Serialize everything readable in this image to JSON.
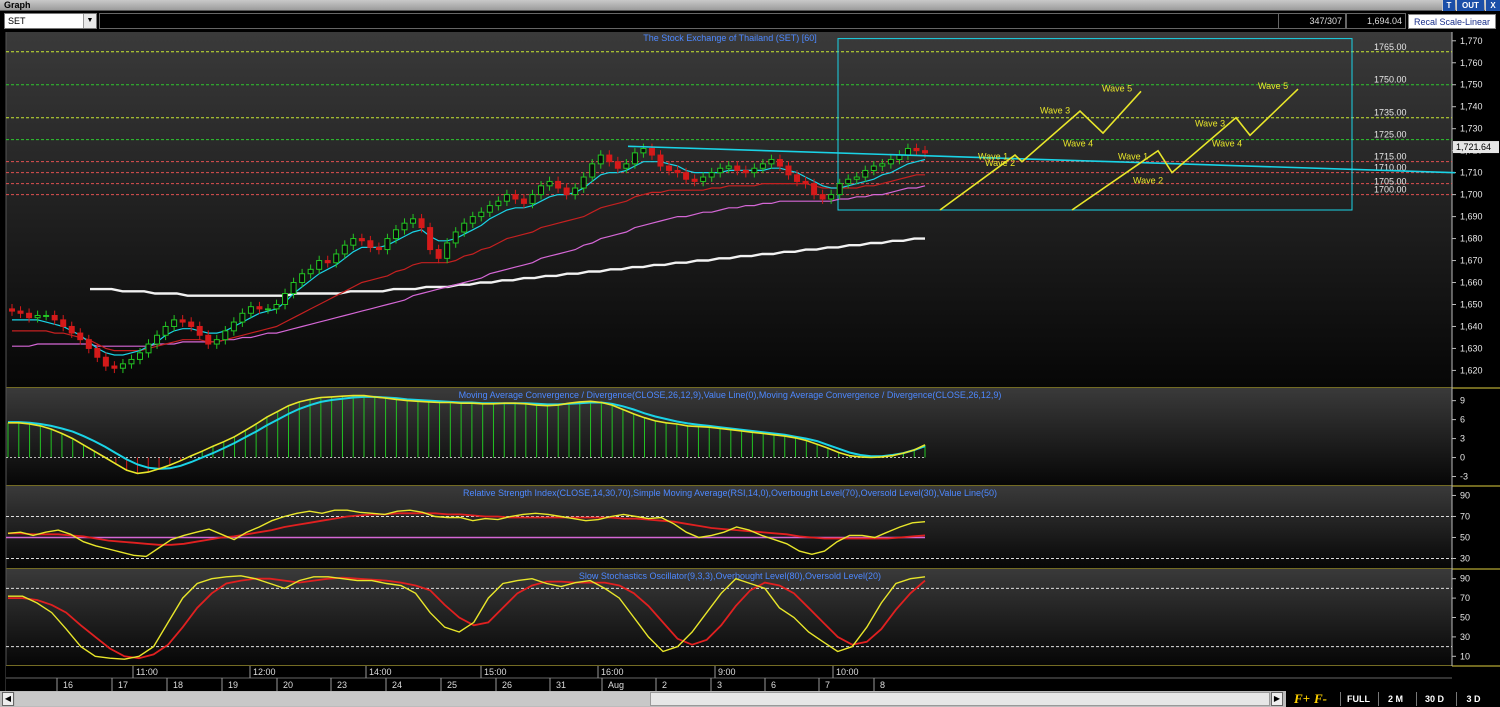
{
  "window": {
    "title": "Graph",
    "btn_t": "T",
    "btn_out": "OUT",
    "btn_x": "X"
  },
  "toolbar": {
    "symbol": "SET",
    "bars": "347/307",
    "value": "1,694.04",
    "recal": "Recal Scale-Linear",
    "dropdown_glyph": "▼"
  },
  "bottom": {
    "left_arrow": "◀",
    "right_arrow": "▶",
    "fplus": "F+",
    "fminus": "F-",
    "full": "FULL",
    "m2": "2 M",
    "d30": "30 D",
    "d3": "3 D"
  },
  "colors": {
    "bg": "#000000",
    "up": "#23c423",
    "down": "#d41a1a",
    "cyan": "#1ad3e6",
    "yellow": "#e8e62a",
    "pink": "#d567d6",
    "white": "#f2f2f2",
    "red_ma": "#c42020",
    "gridText": "#e6e6e6",
    "title": "#4d88ff"
  },
  "chart_data": [
    {
      "id": "price",
      "type": "candlestick",
      "title": "The Stock Exchange of Thailand (SET) [60]",
      "y_ticks": [
        1620,
        1630,
        1640,
        1650,
        1660,
        1670,
        1680,
        1690,
        1700,
        1710,
        1720,
        1730,
        1740,
        1750,
        1760,
        1770
      ],
      "ylim": [
        1612,
        1774
      ],
      "last_value": "1,721.64",
      "h_levels": [
        {
          "value": 1765,
          "label": "1765.00",
          "color": "#c8e832"
        },
        {
          "value": 1750,
          "label": "1750.00",
          "color": "#2ec82e"
        },
        {
          "value": 1735,
          "label": "1735.00",
          "color": "#c8e832"
        },
        {
          "value": 1725,
          "label": "1725.00",
          "color": "#2ec82e"
        },
        {
          "value": 1715,
          "label": "1715.00",
          "color": "#e05050"
        },
        {
          "value": 1710,
          "label": "1710.00",
          "color": "#e05050"
        },
        {
          "value": 1705,
          "label": "1705.00",
          "color": "#e05050"
        },
        {
          "value": 1700,
          "label": "1700.00",
          "color": "#e05050"
        }
      ],
      "close_path": [
        1647,
        1646,
        1644,
        1645,
        1645,
        1643,
        1640,
        1637,
        1634,
        1630,
        1626,
        1622,
        1621,
        1623,
        1625,
        1628,
        1632,
        1636,
        1640,
        1643,
        1642,
        1640,
        1636,
        1632,
        1634,
        1638,
        1642,
        1646,
        1649,
        1648,
        1648,
        1650,
        1655,
        1660,
        1664,
        1666,
        1670,
        1669,
        1673,
        1677,
        1680,
        1679,
        1676,
        1675,
        1680,
        1684,
        1687,
        1689,
        1685,
        1675,
        1671,
        1678,
        1683,
        1687,
        1690,
        1692,
        1695,
        1697,
        1700,
        1698,
        1696,
        1700,
        1704,
        1706,
        1703,
        1700,
        1703,
        1708,
        1714,
        1718,
        1715,
        1712,
        1714,
        1719,
        1721,
        1718,
        1713,
        1711,
        1710,
        1707,
        1706,
        1708,
        1710,
        1712,
        1713,
        1711,
        1710,
        1712,
        1714,
        1716,
        1713,
        1709,
        1706,
        1705,
        1700,
        1698,
        1700,
        1705,
        1707,
        1708,
        1711,
        1713,
        1714,
        1716,
        1718,
        1721,
        1720,
        1719
      ],
      "ema_cyan": [
        1643,
        1643,
        1643,
        1643,
        1642,
        1641,
        1640,
        1638,
        1636,
        1633,
        1630,
        1628,
        1627,
        1627,
        1628,
        1629,
        1631,
        1633,
        1636,
        1638,
        1639,
        1639,
        1638,
        1637,
        1637,
        1638,
        1640,
        1642,
        1644,
        1646,
        1647,
        1648,
        1651,
        1655,
        1658,
        1661,
        1664,
        1666,
        1668,
        1671,
        1674,
        1676,
        1676,
        1676,
        1677,
        1679,
        1681,
        1683,
        1684,
        1681,
        1679,
        1679,
        1680,
        1682,
        1684,
        1686,
        1689,
        1691,
        1693,
        1694,
        1694,
        1695,
        1697,
        1699,
        1700,
        1700,
        1701,
        1703,
        1706,
        1709,
        1710,
        1710,
        1711,
        1713,
        1715,
        1715,
        1715,
        1714,
        1713,
        1711,
        1710,
        1710,
        1710,
        1710,
        1711,
        1711,
        1711,
        1711,
        1711,
        1712,
        1712,
        1711,
        1710,
        1708,
        1706,
        1704,
        1703,
        1703,
        1704,
        1705,
        1706,
        1707,
        1709,
        1710,
        1712,
        1714,
        1715,
        1716
      ],
      "ema_red": [
        1638,
        1638,
        1638,
        1638,
        1638,
        1637,
        1637,
        1636,
        1635,
        1634,
        1632,
        1630,
        1629,
        1629,
        1629,
        1629,
        1630,
        1631,
        1632,
        1633,
        1634,
        1634,
        1634,
        1633,
        1633,
        1634,
        1635,
        1636,
        1637,
        1638,
        1639,
        1640,
        1642,
        1644,
        1646,
        1648,
        1650,
        1652,
        1654,
        1656,
        1658,
        1660,
        1661,
        1662,
        1663,
        1665,
        1666,
        1668,
        1669,
        1669,
        1669,
        1669,
        1670,
        1672,
        1673,
        1675,
        1676,
        1678,
        1680,
        1681,
        1682,
        1683,
        1685,
        1686,
        1687,
        1688,
        1689,
        1690,
        1692,
        1694,
        1695,
        1696,
        1697,
        1699,
        1700,
        1701,
        1701,
        1702,
        1702,
        1702,
        1702,
        1702,
        1703,
        1703,
        1704,
        1704,
        1704,
        1704,
        1705,
        1705,
        1705,
        1705,
        1705,
        1705,
        1704,
        1703,
        1703,
        1703,
        1703,
        1703,
        1704,
        1704,
        1705,
        1706,
        1707,
        1708,
        1709,
        1709
      ],
      "ema_pink": [
        1631,
        1631,
        1631,
        1632,
        1632,
        1632,
        1632,
        1632,
        1632,
        1632,
        1631,
        1631,
        1631,
        1631,
        1631,
        1631,
        1631,
        1632,
        1632,
        1632,
        1633,
        1633,
        1633,
        1633,
        1633,
        1634,
        1634,
        1635,
        1635,
        1636,
        1637,
        1637,
        1638,
        1639,
        1640,
        1641,
        1642,
        1643,
        1644,
        1645,
        1646,
        1647,
        1648,
        1649,
        1650,
        1651,
        1652,
        1654,
        1655,
        1656,
        1657,
        1658,
        1659,
        1660,
        1661,
        1662,
        1664,
        1665,
        1666,
        1667,
        1668,
        1669,
        1671,
        1672,
        1673,
        1674,
        1675,
        1677,
        1678,
        1680,
        1681,
        1682,
        1683,
        1685,
        1686,
        1687,
        1688,
        1689,
        1690,
        1690,
        1691,
        1692,
        1692,
        1693,
        1694,
        1694,
        1695,
        1695,
        1696,
        1696,
        1697,
        1697,
        1697,
        1697,
        1697,
        1697,
        1697,
        1698,
        1698,
        1699,
        1699,
        1700,
        1700,
        1701,
        1702,
        1703,
        1703,
        1704
      ],
      "ema_white": [
        1657,
        1657,
        1657,
        1656,
        1656,
        1656,
        1655,
        1655,
        1655,
        1654,
        1654,
        1654,
        1654,
        1654,
        1654,
        1654,
        1654,
        1654,
        1654,
        1655,
        1655,
        1655,
        1655,
        1655,
        1656,
        1656,
        1656,
        1656,
        1657,
        1657,
        1657,
        1658,
        1658,
        1658,
        1659,
        1659,
        1660,
        1660,
        1661,
        1661,
        1662,
        1662,
        1663,
        1663,
        1664,
        1664,
        1665,
        1665,
        1666,
        1666,
        1667,
        1667,
        1668,
        1668,
        1669,
        1669,
        1670,
        1670,
        1671,
        1671,
        1672,
        1672,
        1673,
        1673,
        1674,
        1674,
        1675,
        1675,
        1676,
        1676,
        1677,
        1677,
        1678,
        1678,
        1679,
        1679,
        1680,
        1680
      ],
      "trendline": [
        [
          1715,
          1722
        ],
        [
          1758,
          1710
        ]
      ],
      "wave_annotations": [
        "Wave 1",
        "Wave 2",
        "Wave 3",
        "Wave 4",
        "Wave 5",
        "Wave 1",
        "Wave 2",
        "Wave 3",
        "Wave 4",
        "Wave 5"
      ],
      "wave_path_1": [
        1693,
        1718,
        1715,
        1738,
        1728,
        1747
      ],
      "wave_path_2": [
        1693,
        1720,
        1710,
        1735,
        1727,
        1748
      ]
    },
    {
      "id": "macd",
      "type": "histogram+line",
      "title": "Moving Average Convergence / Divergence(CLOSE,26,12,9),Value Line(0),Moving Average Convergence / Divergence(CLOSE,26,12,9)",
      "y_ticks": [
        -3,
        0,
        3,
        6,
        9
      ],
      "ylim": [
        -4.5,
        11
      ],
      "histogram": [
        5.5,
        5.5,
        5.3,
        5,
        4.5,
        3.8,
        3,
        2,
        1,
        0,
        -1,
        -2,
        -2.5,
        -2.3,
        -1.8,
        -1.2,
        -0.5,
        0.3,
        1,
        1.8,
        2.5,
        3.3,
        4.3,
        5.3,
        6.4,
        7.3,
        8.2,
        8.8,
        9.2,
        9.5,
        9.6,
        9.7,
        9.8,
        9.8,
        9.6,
        9.4,
        9.2,
        9,
        8.9,
        8.8,
        8.7,
        8.7,
        8.6,
        8.6,
        8.5,
        8.5,
        8.6,
        8.6,
        8.5,
        8.3,
        8.2,
        8.3,
        8.6,
        8.8,
        8.9,
        8.7,
        8.3,
        7.6,
        6.9,
        6.3,
        5.8,
        5.5,
        5.3,
        5,
        4.9,
        4.8,
        4.6,
        4.4,
        4.2,
        4,
        3.8,
        3.6,
        3.4,
        3.1,
        2.7,
        2.1,
        1.5,
        0.8,
        0.3,
        0.1,
        0,
        0.1,
        0.3,
        0.7,
        1.2,
        2
      ],
      "line_yellow": [
        5.5,
        5.5,
        5.3,
        5,
        4.5,
        3.8,
        3,
        2,
        1,
        0,
        -1,
        -2,
        -2.5,
        -2.3,
        -1.8,
        -1.2,
        -0.5,
        0.3,
        1,
        1.8,
        2.5,
        3.3,
        4.3,
        5.3,
        6.4,
        7.3,
        8.2,
        8.8,
        9.2,
        9.5,
        9.6,
        9.7,
        9.8,
        9.8,
        9.6,
        9.4,
        9.2,
        9,
        8.9,
        8.8,
        8.7,
        8.7,
        8.6,
        8.6,
        8.5,
        8.5,
        8.6,
        8.6,
        8.5,
        8.3,
        8.2,
        8.3,
        8.6,
        8.8,
        8.9,
        8.7,
        8.3,
        7.6,
        6.9,
        6.3,
        5.8,
        5.5,
        5.3,
        5,
        4.9,
        4.8,
        4.6,
        4.4,
        4.2,
        4,
        3.8,
        3.6,
        3.4,
        3.1,
        2.7,
        2.1,
        1.5,
        0.8,
        0.3,
        0.1,
        0,
        0.1,
        0.3,
        0.7,
        1.2,
        2
      ],
      "line_cyan": [
        5.6,
        5.6,
        5.5,
        5.3,
        5,
        4.6,
        4.1,
        3.4,
        2.6,
        1.7,
        0.7,
        -0.3,
        -1.1,
        -1.6,
        -1.8,
        -1.7,
        -1.3,
        -0.7,
        0,
        0.7,
        1.5,
        2.3,
        3.2,
        4.1,
        5.1,
        6,
        6.9,
        7.7,
        8.3,
        8.8,
        9.1,
        9.3,
        9.5,
        9.6,
        9.6,
        9.5,
        9.4,
        9.2,
        9.1,
        9,
        8.9,
        8.8,
        8.7,
        8.7,
        8.6,
        8.6,
        8.6,
        8.6,
        8.6,
        8.5,
        8.4,
        8.4,
        8.5,
        8.6,
        8.7,
        8.7,
        8.5,
        8.1,
        7.6,
        7,
        6.5,
        6.1,
        5.7,
        5.4,
        5.2,
        5,
        4.8,
        4.6,
        4.4,
        4.2,
        4,
        3.8,
        3.6,
        3.3,
        3,
        2.6,
        2,
        1.4,
        0.8,
        0.4,
        0.2,
        0.2,
        0.4,
        0.7,
        1.2,
        1.8
      ]
    },
    {
      "id": "rsi",
      "type": "line",
      "title": "Relative Strength Index(CLOSE,14,30,70),Simple Moving Average(RSI,14,0),Overbought Level(70),Oversold Level(30),Value Line(50)",
      "y_ticks": [
        30,
        50,
        70,
        90
      ],
      "ylim": [
        20,
        99
      ],
      "overbought": 70,
      "oversold": 30,
      "value_line": 50,
      "rsi": [
        54,
        55,
        52,
        55,
        57,
        53,
        46,
        42,
        39,
        36,
        33,
        32,
        40,
        48,
        52,
        55,
        58,
        53,
        48,
        55,
        60,
        66,
        70,
        73,
        75,
        73,
        76,
        76,
        74,
        73,
        72,
        75,
        76,
        74,
        70,
        69,
        69,
        66,
        68,
        67,
        70,
        72,
        73,
        72,
        70,
        68,
        66,
        67,
        70,
        72,
        70,
        68,
        69,
        63,
        55,
        50,
        52,
        55,
        60,
        57,
        52,
        48,
        44,
        37,
        34,
        37,
        46,
        52,
        52,
        50,
        55,
        60,
        64,
        65
      ],
      "sma": [
        54,
        54,
        53,
        53,
        53,
        52,
        51,
        49,
        47,
        46,
        45,
        44,
        43,
        43,
        44,
        46,
        48,
        50,
        51,
        53,
        55,
        57,
        60,
        62,
        64,
        66,
        68,
        70,
        71,
        72,
        72,
        73,
        73,
        73,
        73,
        72,
        72,
        71,
        70,
        70,
        69,
        69,
        69,
        69,
        69,
        69,
        69,
        69,
        69,
        68,
        68,
        67,
        66,
        65,
        63,
        61,
        59,
        58,
        57,
        56,
        55,
        54,
        53,
        51,
        50,
        49,
        49,
        49,
        49,
        49,
        49,
        50,
        51,
        52
      ]
    },
    {
      "id": "stoch",
      "type": "line",
      "title": "Slow Stochastics Oscillator(9,3,3),Overbought Level(80),Oversold Level(20)",
      "y_ticks": [
        10,
        30,
        50,
        70,
        90
      ],
      "ylim": [
        0,
        100
      ],
      "overbought": 80,
      "oversold": 20,
      "k": [
        72,
        72,
        65,
        55,
        38,
        20,
        10,
        8,
        7,
        10,
        20,
        45,
        70,
        85,
        90,
        92,
        93,
        90,
        85,
        80,
        88,
        92,
        92,
        90,
        88,
        88,
        85,
        83,
        75,
        55,
        40,
        35,
        45,
        70,
        85,
        88,
        90,
        85,
        82,
        86,
        88,
        80,
        70,
        50,
        30,
        15,
        20,
        35,
        55,
        75,
        90,
        85,
        80,
        60,
        50,
        35,
        25,
        15,
        20,
        40,
        65,
        85,
        90,
        92
      ],
      "d": [
        70,
        70,
        68,
        63,
        55,
        42,
        30,
        18,
        10,
        8,
        12,
        22,
        40,
        60,
        75,
        85,
        88,
        90,
        90,
        88,
        86,
        88,
        90,
        91,
        90,
        89,
        88,
        86,
        83,
        78,
        63,
        50,
        42,
        45,
        60,
        75,
        83,
        87,
        87,
        86,
        86,
        86,
        83,
        75,
        62,
        45,
        28,
        22,
        27,
        42,
        62,
        78,
        86,
        83,
        75,
        60,
        45,
        30,
        22,
        25,
        38,
        58,
        75,
        88
      ]
    }
  ],
  "x_axis": {
    "time_labels": [
      "11:00",
      "12:00",
      "14:00",
      "15:00",
      "16:00",
      "9:00",
      "10:00"
    ],
    "date_labels": [
      "16",
      "17",
      "18",
      "19",
      "20",
      "23",
      "24",
      "25",
      "26",
      "31",
      "Aug",
      "2",
      "3",
      "6",
      "7",
      "8"
    ]
  }
}
